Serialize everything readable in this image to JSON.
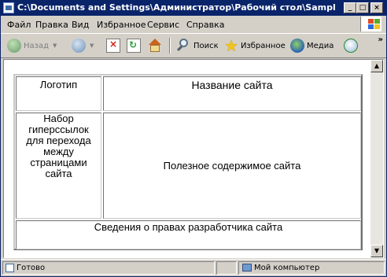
{
  "window": {
    "title": "C:\\Documents and Settings\\Администратор\\Рабочий стол\\Samples\\frame.ht...",
    "controls": {
      "minimize": "_",
      "maximize": "□",
      "close": "×"
    }
  },
  "menu": {
    "items": [
      "Файл",
      "Правка",
      "Вид",
      "Избранное",
      "Сервис",
      "Справка"
    ]
  },
  "toolbar": {
    "back_label": "Назад",
    "search_label": "Поиск",
    "favorites_label": "Избранное",
    "media_label": "Медиа",
    "overflow": "»"
  },
  "page": {
    "logo": "Логотип",
    "site_name": "Название сайта",
    "nav": "Набор гиперссылок для перехода между страницами сайта",
    "main": "Полезное содержимое сайта",
    "footer": "Сведения о правах разработчика сайта"
  },
  "status": {
    "text": "Готово",
    "zone": "Мой компьютер"
  },
  "colors": {
    "titlebar": "#0a246a",
    "chrome": "#d4d0c8",
    "back_arrow": "#3c8c2c",
    "forward_arrow": "#3a6ea5"
  }
}
